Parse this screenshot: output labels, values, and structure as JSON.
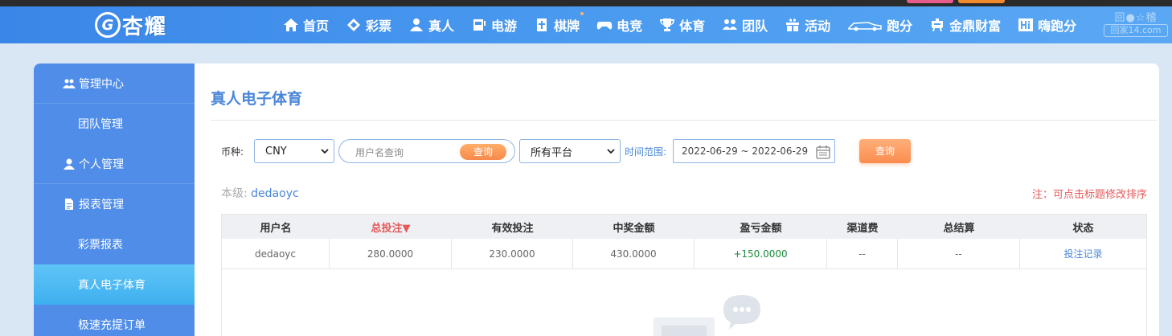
{
  "header": {
    "logo_mark": "G",
    "logo_text": "杏耀",
    "nav": [
      {
        "label": "首页",
        "icon": "home-icon"
      },
      {
        "label": "彩票",
        "icon": "diamond-icon"
      },
      {
        "label": "真人",
        "icon": "person-icon"
      },
      {
        "label": "电游",
        "icon": "slot-machine-icon"
      },
      {
        "label": "棋牌",
        "icon": "card-icon"
      },
      {
        "label": "电竞",
        "icon": "gamepad-icon"
      },
      {
        "label": "体育",
        "icon": "trophy-icon"
      },
      {
        "label": "团队",
        "icon": "team-icon"
      },
      {
        "label": "活动",
        "icon": "gift-icon"
      },
      {
        "label": "跑分",
        "icon": "car-icon"
      },
      {
        "label": "金鼎财富",
        "icon": "tripod-icon"
      },
      {
        "label": "嗨跑分",
        "icon": "hi-icon"
      }
    ],
    "watermark_top": "回●☆稽",
    "watermark_bottom": "回家14.com"
  },
  "sidebar": {
    "groups": [
      {
        "label": "管理中心",
        "icon": "users-icon",
        "items": [
          "团队管理"
        ]
      },
      {
        "label": "个人管理",
        "icon": "user-icon",
        "items": []
      },
      {
        "label": "报表管理",
        "icon": "report-icon",
        "items": [
          "彩票报表",
          "真人电子体育",
          "极速充提订单"
        ]
      }
    ],
    "active_item": "真人电子体育"
  },
  "main": {
    "title": "真人电子体育",
    "filters": {
      "currency_label": "币种:",
      "currency_value": "CNY",
      "search_placeholder": "用户名查询",
      "search_button": "查询",
      "platform_value": "所有平台",
      "range_label": "时间范围:",
      "date_range": "2022-06-29 ~ 2022-06-29",
      "query_button": "查询"
    },
    "level_label": "本级:",
    "level_value": "dedaoyc",
    "note": "注：可点击标题修改排序",
    "table": {
      "headers": [
        "用户名",
        "总投注▼",
        "有效投注",
        "中奖金额",
        "盈亏金额",
        "渠道费",
        "总结算",
        "状态"
      ],
      "rows": [
        [
          "dedaoyc",
          "280.0000",
          "230.0000",
          "430.0000",
          "+150.0000",
          "--",
          "--",
          "投注记录"
        ]
      ]
    }
  },
  "colors": {
    "header_blue": "#3a86e8",
    "sidebar_blue": "#4f8de9",
    "active_cyan": "#3eb0ef",
    "accent_orange": "#f7894a",
    "title_blue": "#4a86d9",
    "note_red": "#e45a5a",
    "profit_green": "#1a8a3a"
  }
}
